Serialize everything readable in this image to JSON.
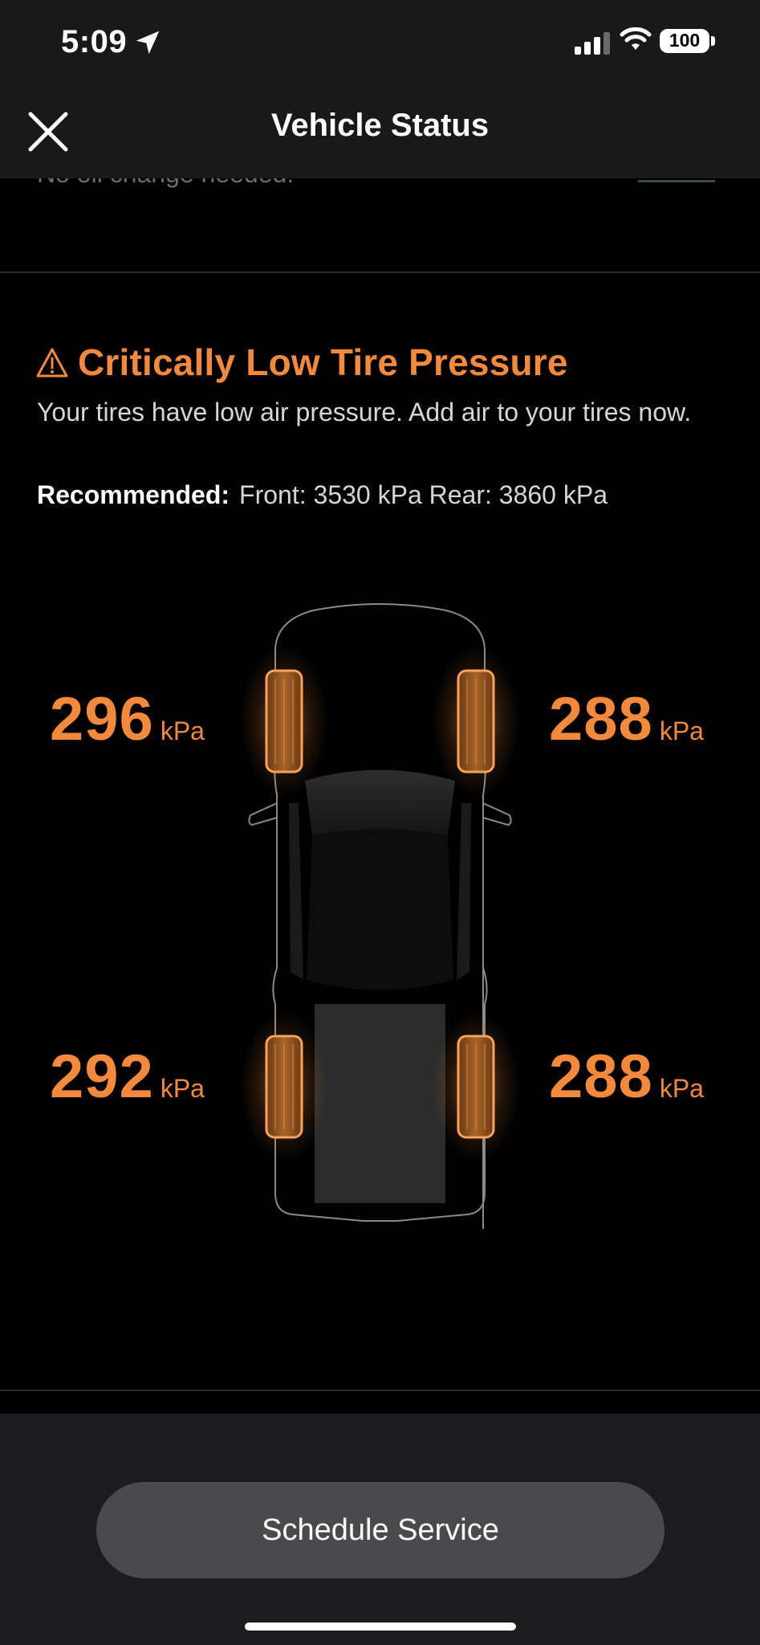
{
  "status_bar": {
    "time": "5:09",
    "battery": "100",
    "icons": [
      "location-arrow-icon",
      "cellular-signal-icon",
      "wifi-icon",
      "battery-icon"
    ]
  },
  "header": {
    "title": "Vehicle Status",
    "close_icon": "close-icon"
  },
  "previous_section": {
    "text": "No oil change needed."
  },
  "alert": {
    "icon": "warning-triangle-icon",
    "title": "Critically Low Tire Pressure",
    "description": "Your tires have low air pressure. Add air to your tires now.",
    "recommended_label": "Recommended:",
    "recommended_value": "Front: 3530 kPa Rear: 3860 kPa"
  },
  "tires": {
    "front_left": {
      "value": "296",
      "unit": "kPa"
    },
    "front_right": {
      "value": "288",
      "unit": "kPa"
    },
    "rear_left": {
      "value": "292",
      "unit": "kPa"
    },
    "rear_right": {
      "value": "288",
      "unit": "kPa"
    }
  },
  "footer": {
    "schedule_button": "Schedule Service"
  },
  "colors": {
    "accent": "#f2893b",
    "background": "#000000",
    "header_bg": "#191919",
    "button_bg": "#4a4a4c"
  }
}
